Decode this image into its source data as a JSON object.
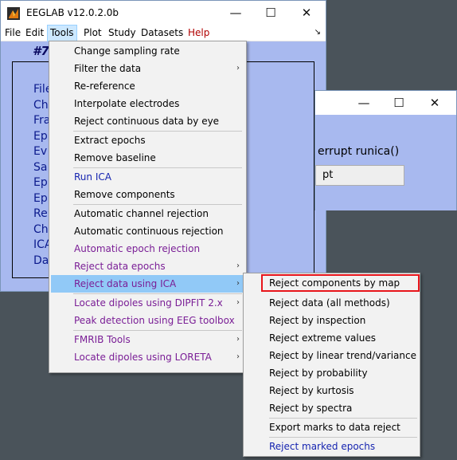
{
  "main_window": {
    "title": "EEGLAB v12.0.2.0b",
    "controls": {
      "minimize": "—",
      "maximize": "☐",
      "close": "✕"
    },
    "menubar": [
      "File",
      "Edit",
      "Tools",
      "Plot",
      "Study",
      "Datasets",
      "Help"
    ],
    "active_menu": "Tools",
    "dock_arrow": "↘",
    "frame_title": "#7",
    "info_labels": [
      "File",
      "Ch",
      "Fra",
      "Ep",
      "Ev",
      "Sa",
      "Ep",
      "Ep",
      "Re",
      "Ch",
      "ICA",
      "Da"
    ]
  },
  "secondary_window": {
    "controls": {
      "minimize": "—",
      "maximize": "☐",
      "close": "✕"
    },
    "text": "errupt runica()",
    "button_label": "pt"
  },
  "tools_menu": {
    "items": [
      {
        "label": "Change sampling rate",
        "color": "normal"
      },
      {
        "label": "Filter the data",
        "color": "normal",
        "submenu": true
      },
      {
        "label": "Re-reference",
        "color": "normal"
      },
      {
        "label": "Interpolate electrodes",
        "color": "normal"
      },
      {
        "label": "Reject continuous data by eye",
        "color": "normal"
      },
      {
        "label": "Extract epochs",
        "color": "normal"
      },
      {
        "label": "Remove baseline",
        "color": "normal"
      },
      {
        "label": "Run ICA",
        "color": "blue"
      },
      {
        "label": "Remove components",
        "color": "normal"
      },
      {
        "label": "Automatic channel rejection",
        "color": "normal"
      },
      {
        "label": "Automatic continuous rejection",
        "color": "normal"
      },
      {
        "label": "Automatic epoch rejection",
        "color": "purple"
      },
      {
        "label": "Reject data epochs",
        "color": "purple",
        "submenu": true
      },
      {
        "label": "Reject data using ICA",
        "color": "purple",
        "submenu": true,
        "highlighted": true
      },
      {
        "label": "Locate dipoles using DIPFIT 2.x",
        "color": "purple",
        "submenu": true
      },
      {
        "label": "Peak detection using EEG toolbox",
        "color": "purple"
      },
      {
        "label": "FMRIB Tools",
        "color": "purple",
        "submenu": true
      },
      {
        "label": "Locate dipoles using LORETA",
        "color": "purple",
        "submenu": true
      }
    ],
    "submenu_arrow": "›"
  },
  "ica_submenu": {
    "items": [
      {
        "label": "Reject components by map",
        "color": "normal",
        "boxed": true
      },
      {
        "label": "Reject data (all methods)",
        "color": "normal"
      },
      {
        "label": "Reject by inspection",
        "color": "normal"
      },
      {
        "label": "Reject extreme values",
        "color": "normal"
      },
      {
        "label": "Reject by linear trend/variance",
        "color": "normal"
      },
      {
        "label": "Reject by probability",
        "color": "normal"
      },
      {
        "label": "Reject by kurtosis",
        "color": "normal"
      },
      {
        "label": "Reject by spectra",
        "color": "normal"
      },
      {
        "label": "Export marks to data reject",
        "color": "normal"
      },
      {
        "label": "Reject marked epochs",
        "color": "blue"
      }
    ]
  },
  "colors": {
    "background": "#4a535a",
    "panel": "#a8b9ef",
    "highlight": "#91c9f7",
    "annotation_box": "#e8151b"
  }
}
